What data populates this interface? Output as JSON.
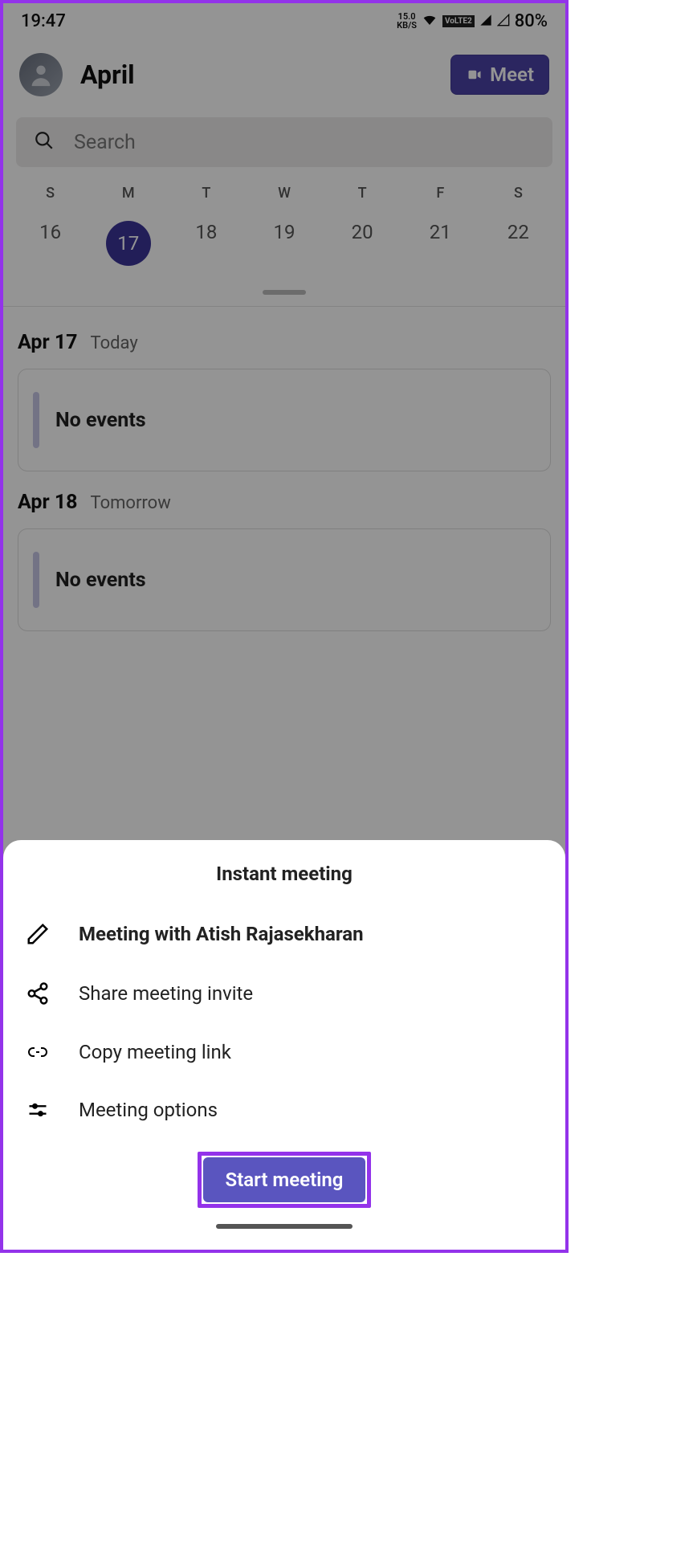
{
  "statusBar": {
    "time": "19:47",
    "speed": "15.0",
    "speedUnit": "KB/S",
    "lte": "VoLTE2",
    "battery": "80%"
  },
  "header": {
    "month": "April",
    "meetLabel": "Meet"
  },
  "search": {
    "placeholder": "Search"
  },
  "weekDays": [
    "S",
    "M",
    "T",
    "W",
    "T",
    "F",
    "S"
  ],
  "dates": [
    "16",
    "17",
    "18",
    "19",
    "20",
    "21",
    "22"
  ],
  "selectedIndex": 1,
  "days": [
    {
      "date": "Apr 17",
      "label": "Today",
      "content": "No events"
    },
    {
      "date": "Apr 18",
      "label": "Tomorrow",
      "content": "No events"
    }
  ],
  "sheet": {
    "title": "Instant meeting",
    "items": [
      {
        "icon": "edit-icon",
        "label": "Meeting with Atish Rajasekharan"
      },
      {
        "icon": "share-icon",
        "label": "Share meeting invite"
      },
      {
        "icon": "link-icon",
        "label": "Copy meeting link"
      },
      {
        "icon": "options-icon",
        "label": "Meeting options"
      }
    ],
    "startLabel": "Start meeting"
  }
}
